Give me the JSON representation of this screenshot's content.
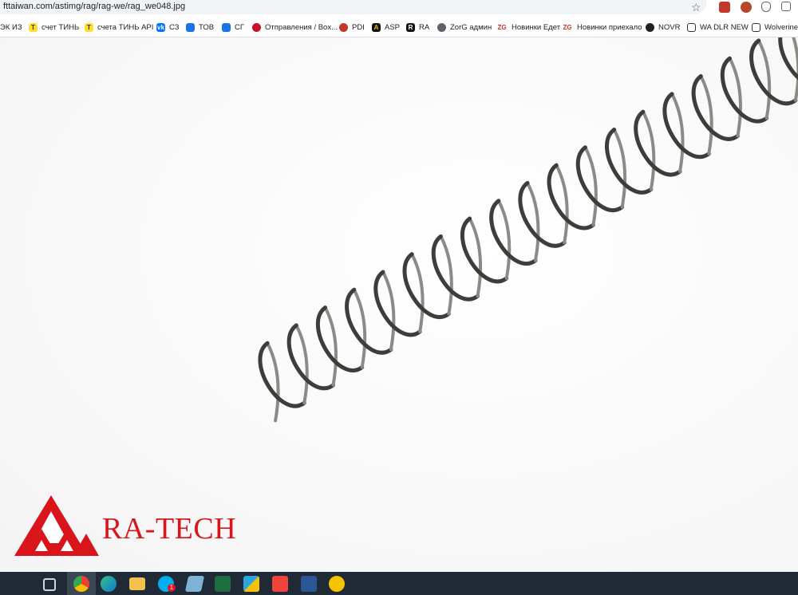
{
  "browser": {
    "url": "fttaiwan.com/astimg/rag/rag-we/rag_we048.jpg"
  },
  "bookmarks": [
    {
      "label": "ЭК ИЗ",
      "icon": "text-bookmark",
      "color": "#ffffff"
    },
    {
      "label": "счет ТИНЬ",
      "icon": "tinkoff-icon",
      "color": "#ffdd2d"
    },
    {
      "label": "счета ТИНЬ API",
      "icon": "tinkoff-icon",
      "color": "#ffdd2d"
    },
    {
      "label": "СЗ",
      "icon": "vk-icon",
      "color": "#0077ff"
    },
    {
      "label": "ТОВ",
      "icon": "chat-icon",
      "color": "#1a73e8"
    },
    {
      "label": "СГ",
      "icon": "chat-icon",
      "color": "#1a73e8"
    },
    {
      "label": "Отправления / Box...",
      "icon": "boxberry-icon",
      "color": "#c8102e"
    },
    {
      "label": "PDI",
      "icon": "pdi-icon",
      "color": "#c0392b"
    },
    {
      "label": "ASP",
      "icon": "asp-icon",
      "color": "#111111"
    },
    {
      "label": "RA",
      "icon": "ra-icon",
      "color": "#111111"
    },
    {
      "label": "ZorG админ",
      "icon": "globe-icon",
      "color": "#5f6368"
    },
    {
      "label": "Новинки Едет",
      "icon": "zg-icon",
      "color": "#d93025"
    },
    {
      "label": "Новинки приехало",
      "icon": "zg-icon",
      "color": "#d93025"
    },
    {
      "label": "NOVR",
      "icon": "novr-icon",
      "color": "#222222"
    },
    {
      "label": "WA DLR NEW",
      "icon": "wa-icon",
      "color": "#333333"
    },
    {
      "label": "Wolverine",
      "icon": "wolverine-icon",
      "color": "#333333"
    }
  ],
  "image": {
    "subject": "spring-image",
    "logo_text": "RA-TECH",
    "logo_color": "#d9141b"
  },
  "taskbar": {
    "items": [
      "task-view-icon",
      "chrome-icon",
      "edge-icon",
      "file-explorer-icon",
      "skype-icon",
      "notepad-icon",
      "excel-icon",
      "app-icon",
      "anydesk-icon",
      "word-icon",
      "1c-icon"
    ],
    "skype_badge": "1"
  }
}
